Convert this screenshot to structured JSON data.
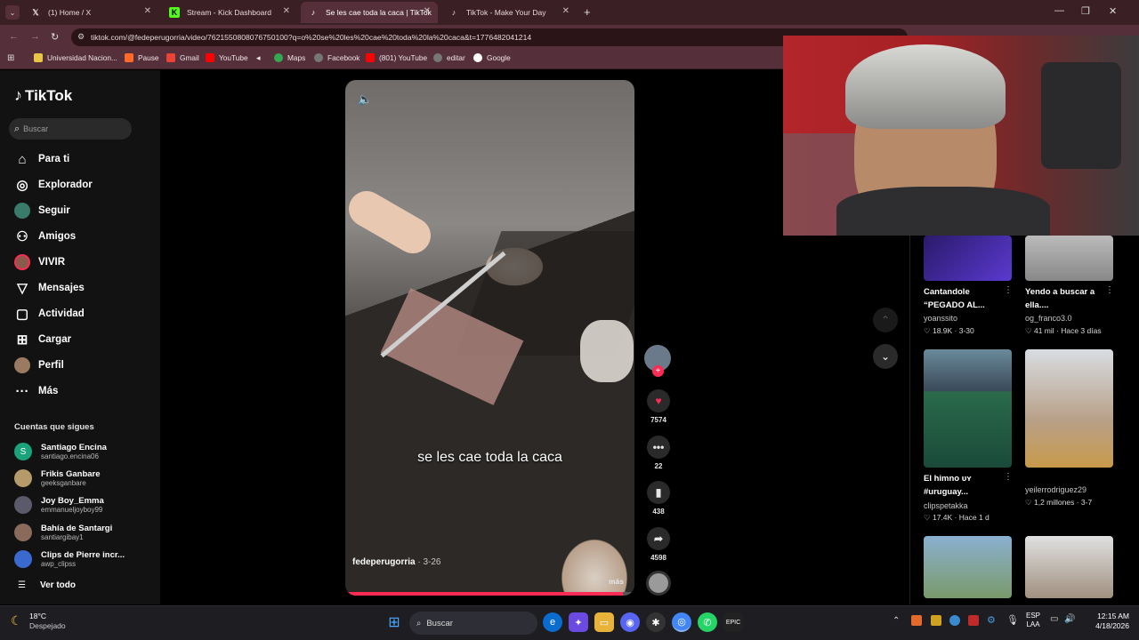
{
  "browser": {
    "tabs": [
      {
        "label": "(1) Home / X",
        "icon": "x-logo-icon"
      },
      {
        "label": "Stream - Kick Dashboard",
        "icon": "kick-logo-icon"
      },
      {
        "label": "Se les cae toda la caca | TikTok",
        "icon": "tiktok-logo-icon"
      },
      {
        "label": "TikTok - Make Your Day",
        "icon": "tiktok-logo-icon"
      }
    ],
    "url": "tiktok.com/@fedeperugorria/video/7621550808076750100?q=o%20se%20les%20cae%20toda%20la%20caca&t=1776482041214",
    "bookmarks": [
      {
        "label": "Universidad Nacion..."
      },
      {
        "label": "Pause"
      },
      {
        "label": "Gmail"
      },
      {
        "label": "YouTube"
      },
      {
        "label": "Maps"
      },
      {
        "label": "Facebook"
      },
      {
        "label": "(801) YouTube"
      },
      {
        "label": "editar"
      },
      {
        "label": "Google"
      }
    ]
  },
  "sidebar": {
    "logo": "TikTok",
    "search_placeholder": "Buscar",
    "nav": [
      {
        "label": "Para ti"
      },
      {
        "label": "Explorador"
      },
      {
        "label": "Seguir"
      },
      {
        "label": "Amigos"
      },
      {
        "label": "VIVIR"
      },
      {
        "label": "Mensajes"
      },
      {
        "label": "Actividad"
      },
      {
        "label": "Cargar"
      },
      {
        "label": "Perfil"
      },
      {
        "label": "Más"
      }
    ],
    "following_title": "Cuentas que sigues",
    "following": [
      {
        "name": "Santiago Encina",
        "handle": "santiago.encina06",
        "initial": "S"
      },
      {
        "name": "Frikis Ganbare",
        "handle": "geeksganbare",
        "initial": ""
      },
      {
        "name": "Joy Boy_Emma",
        "handle": "emmanueljoyboy99",
        "initial": ""
      },
      {
        "name": "Bahía de Santargi",
        "handle": "santiargibay1",
        "initial": ""
      },
      {
        "name": "Clips de Pierre incr...",
        "handle": "awp_clipss",
        "initial": ""
      }
    ],
    "see_all": "Ver todo"
  },
  "video": {
    "caption": "se les cae toda la caca",
    "author": "fedeperugorria",
    "date": "3-26",
    "more": "más",
    "likes": "7574",
    "comments": "22",
    "saves": "438",
    "shares": "4598",
    "progress": 0.96
  },
  "recommendations": [
    {
      "title1": "Cantandole",
      "title2": "“PEGADO AL...",
      "user": "yoanssito",
      "stats": "18.9K · 3-30"
    },
    {
      "title1": "Yendo a buscar a",
      "title2": "ella....",
      "user": "og_franco3.0",
      "stats": "41 mil · Hace 3 días"
    },
    {
      "title1": "El himno ᴜʏ",
      "title2": "#uruguay...",
      "user": "clipspetakka",
      "stats": "17.4K · Hace 1 d"
    },
    {
      "title1": "",
      "title2": "",
      "user": "yeilerrodriguez29",
      "stats": "1,2 millones · 3-7"
    }
  ],
  "taskbar": {
    "weather_temp": "18°C",
    "weather_desc": "Despejado",
    "search": "Buscar",
    "lang1": "ESP",
    "lang2": "LAA",
    "time": "12:15 AM",
    "date": "4/18/2026"
  },
  "colors": {
    "accent": "#fe2c55",
    "tab_bg": "#3a1f24",
    "toolbar_bg": "#55303a"
  }
}
